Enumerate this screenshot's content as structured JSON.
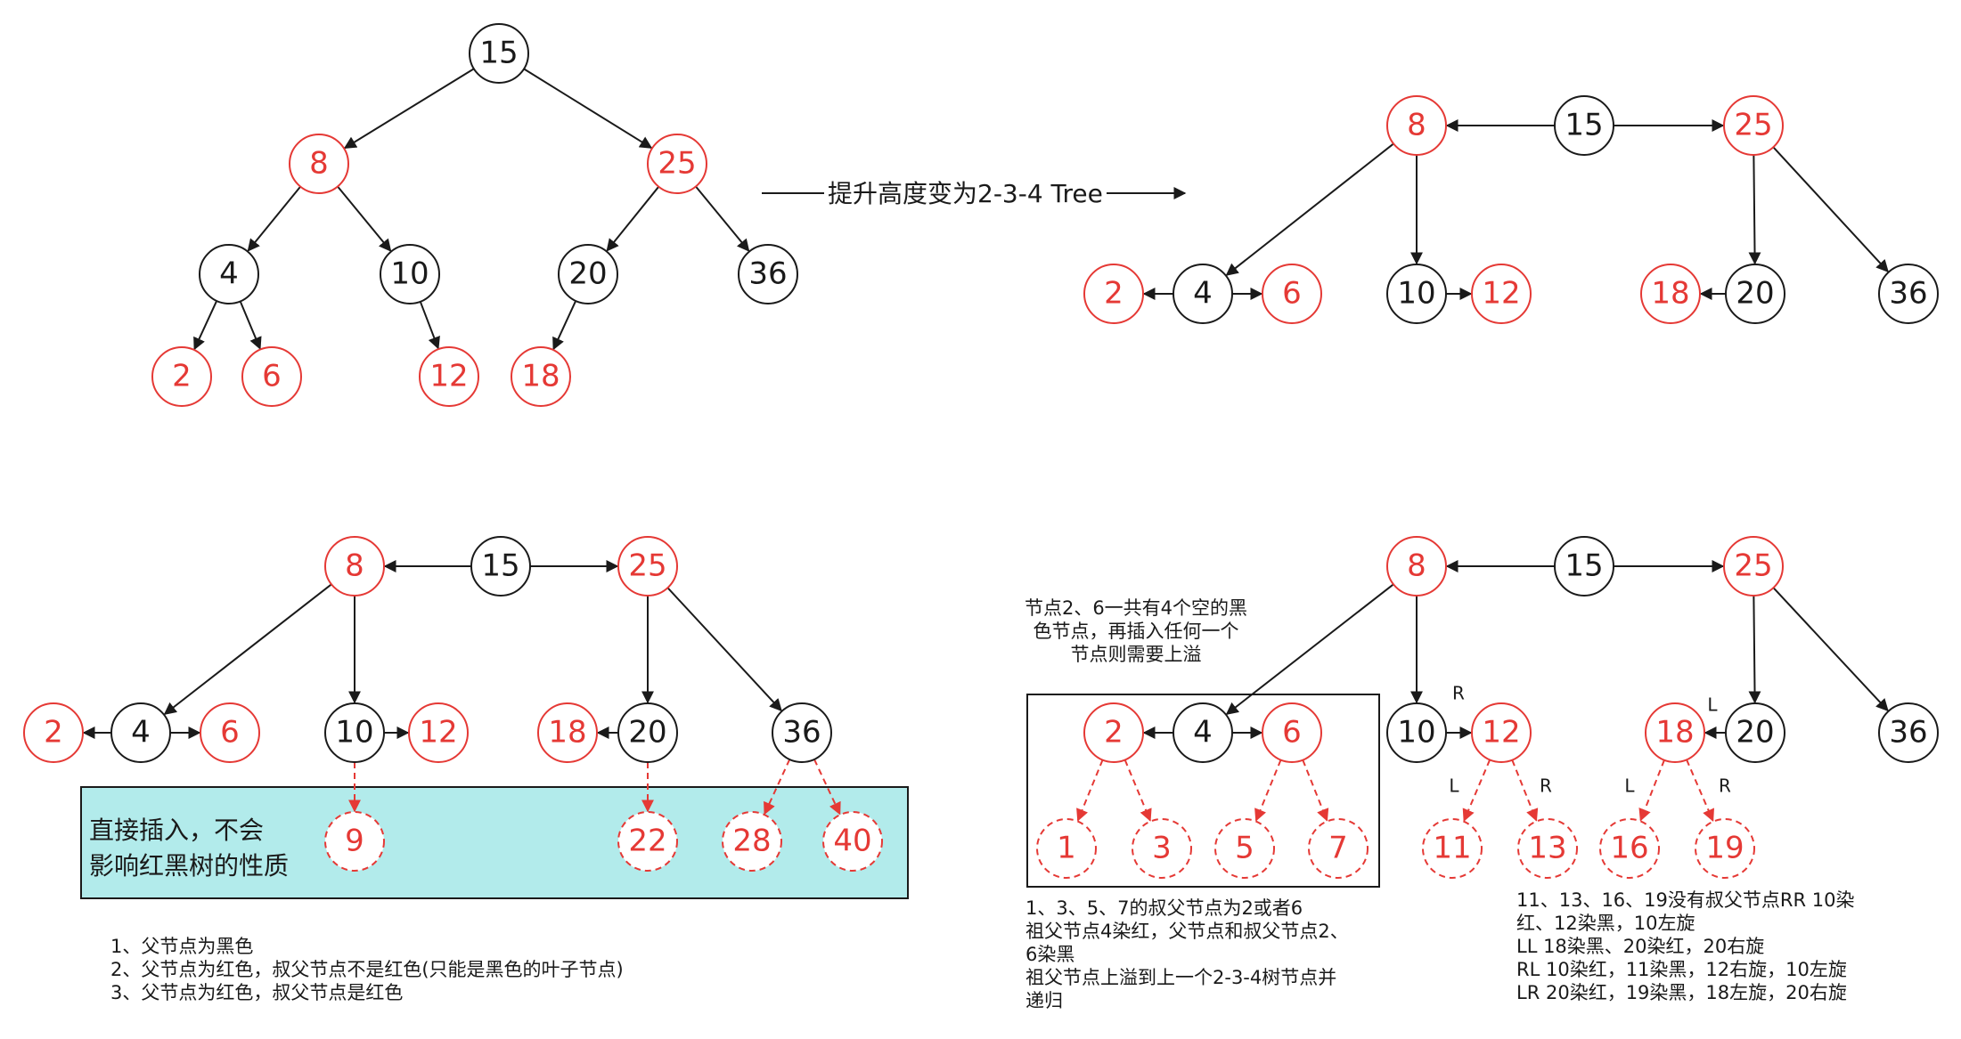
{
  "colors": {
    "red": "#e53935",
    "black": "#1a1a1a",
    "cyan": "#b2ebeb",
    "white": "#ffffff"
  },
  "top_arrow_label": "提升高度变为2-3-4 Tree",
  "tl_tree": {
    "nodes": [
      {
        "id": "15",
        "label": "15",
        "color": "black"
      },
      {
        "id": "8",
        "label": "8",
        "color": "red"
      },
      {
        "id": "25",
        "label": "25",
        "color": "red"
      },
      {
        "id": "4",
        "label": "4",
        "color": "black"
      },
      {
        "id": "10",
        "label": "10",
        "color": "black"
      },
      {
        "id": "20",
        "label": "20",
        "color": "black"
      },
      {
        "id": "36",
        "label": "36",
        "color": "black"
      },
      {
        "id": "2",
        "label": "2",
        "color": "red"
      },
      {
        "id": "6",
        "label": "6",
        "color": "red"
      },
      {
        "id": "12",
        "label": "12",
        "color": "red"
      },
      {
        "id": "18",
        "label": "18",
        "color": "red"
      }
    ],
    "edges": [
      {
        "from": "15",
        "to": "8"
      },
      {
        "from": "15",
        "to": "25"
      },
      {
        "from": "8",
        "to": "4"
      },
      {
        "from": "8",
        "to": "10"
      },
      {
        "from": "25",
        "to": "20"
      },
      {
        "from": "25",
        "to": "36"
      },
      {
        "from": "4",
        "to": "2"
      },
      {
        "from": "4",
        "to": "6"
      },
      {
        "from": "10",
        "to": "12"
      },
      {
        "from": "20",
        "to": "18"
      }
    ]
  },
  "tr_tree": {
    "nodes": [
      {
        "id": "8",
        "label": "8",
        "color": "red"
      },
      {
        "id": "15",
        "label": "15",
        "color": "black"
      },
      {
        "id": "25",
        "label": "25",
        "color": "red"
      },
      {
        "id": "2",
        "label": "2",
        "color": "red"
      },
      {
        "id": "4",
        "label": "4",
        "color": "black"
      },
      {
        "id": "6",
        "label": "6",
        "color": "red"
      },
      {
        "id": "10",
        "label": "10",
        "color": "black"
      },
      {
        "id": "12",
        "label": "12",
        "color": "red"
      },
      {
        "id": "18",
        "label": "18",
        "color": "red"
      },
      {
        "id": "20",
        "label": "20",
        "color": "black"
      },
      {
        "id": "36",
        "label": "36",
        "color": "black"
      }
    ],
    "edges": [
      {
        "from": "15",
        "to": "8"
      },
      {
        "from": "15",
        "to": "25"
      },
      {
        "from": "8",
        "to": "4"
      },
      {
        "from": "8",
        "to": "10"
      },
      {
        "from": "25",
        "to": "20"
      },
      {
        "from": "25",
        "to": "36"
      },
      {
        "from": "4",
        "to": "2"
      },
      {
        "from": "4",
        "to": "6"
      },
      {
        "from": "10",
        "to": "12"
      },
      {
        "from": "20",
        "to": "18"
      }
    ]
  },
  "bl_tree": {
    "nodes": [
      {
        "id": "8",
        "label": "8",
        "color": "red"
      },
      {
        "id": "15",
        "label": "15",
        "color": "black"
      },
      {
        "id": "25",
        "label": "25",
        "color": "red"
      },
      {
        "id": "2",
        "label": "2",
        "color": "red"
      },
      {
        "id": "4",
        "label": "4",
        "color": "black"
      },
      {
        "id": "6",
        "label": "6",
        "color": "red"
      },
      {
        "id": "10",
        "label": "10",
        "color": "black"
      },
      {
        "id": "12",
        "label": "12",
        "color": "red"
      },
      {
        "id": "18",
        "label": "18",
        "color": "red"
      },
      {
        "id": "20",
        "label": "20",
        "color": "black"
      },
      {
        "id": "36",
        "label": "36",
        "color": "black"
      },
      {
        "id": "9",
        "label": "9",
        "color": "red",
        "dashed": true
      },
      {
        "id": "22",
        "label": "22",
        "color": "red",
        "dashed": true
      },
      {
        "id": "28",
        "label": "28",
        "color": "red",
        "dashed": true
      },
      {
        "id": "40",
        "label": "40",
        "color": "red",
        "dashed": true
      }
    ],
    "edges": [
      {
        "from": "15",
        "to": "8"
      },
      {
        "from": "15",
        "to": "25"
      },
      {
        "from": "8",
        "to": "4"
      },
      {
        "from": "8",
        "to": "10"
      },
      {
        "from": "25",
        "to": "20"
      },
      {
        "from": "25",
        "to": "36"
      },
      {
        "from": "4",
        "to": "2"
      },
      {
        "from": "4",
        "to": "6"
      },
      {
        "from": "10",
        "to": "12"
      },
      {
        "from": "20",
        "to": "18"
      },
      {
        "from": "10",
        "to": "9",
        "dashed": true
      },
      {
        "from": "20",
        "to": "22",
        "dashed": true
      },
      {
        "from": "36",
        "to": "28",
        "dashed": true
      },
      {
        "from": "36",
        "to": "40",
        "dashed": true
      }
    ],
    "box_label_1": "直接插入，不会",
    "box_label_2": "影响红黑树的性质"
  },
  "br_tree": {
    "nodes": [
      {
        "id": "8",
        "label": "8",
        "color": "red"
      },
      {
        "id": "15",
        "label": "15",
        "color": "black"
      },
      {
        "id": "25",
        "label": "25",
        "color": "red"
      },
      {
        "id": "2",
        "label": "2",
        "color": "red"
      },
      {
        "id": "4",
        "label": "4",
        "color": "black"
      },
      {
        "id": "6",
        "label": "6",
        "color": "red"
      },
      {
        "id": "10",
        "label": "10",
        "color": "black"
      },
      {
        "id": "12",
        "label": "12",
        "color": "red"
      },
      {
        "id": "18",
        "label": "18",
        "color": "red"
      },
      {
        "id": "20",
        "label": "20",
        "color": "black"
      },
      {
        "id": "36",
        "label": "36",
        "color": "black"
      },
      {
        "id": "1",
        "label": "1",
        "color": "red",
        "dashed": true
      },
      {
        "id": "3",
        "label": "3",
        "color": "red",
        "dashed": true
      },
      {
        "id": "5",
        "label": "5",
        "color": "red",
        "dashed": true
      },
      {
        "id": "7",
        "label": "7",
        "color": "red",
        "dashed": true
      },
      {
        "id": "11",
        "label": "11",
        "color": "red",
        "dashed": true
      },
      {
        "id": "13",
        "label": "13",
        "color": "red",
        "dashed": true
      },
      {
        "id": "16",
        "label": "16",
        "color": "red",
        "dashed": true
      },
      {
        "id": "19",
        "label": "19",
        "color": "red",
        "dashed": true
      }
    ],
    "edges": [
      {
        "from": "15",
        "to": "8"
      },
      {
        "from": "15",
        "to": "25"
      },
      {
        "from": "8",
        "to": "4"
      },
      {
        "from": "8",
        "to": "10"
      },
      {
        "from": "25",
        "to": "20"
      },
      {
        "from": "25",
        "to": "36"
      },
      {
        "from": "4",
        "to": "2"
      },
      {
        "from": "4",
        "to": "6"
      },
      {
        "from": "10",
        "to": "12"
      },
      {
        "from": "20",
        "to": "18"
      },
      {
        "from": "2",
        "to": "1",
        "dashed": true
      },
      {
        "from": "2",
        "to": "3",
        "dashed": true
      },
      {
        "from": "6",
        "to": "5",
        "dashed": true
      },
      {
        "from": "6",
        "to": "7",
        "dashed": true
      },
      {
        "from": "12",
        "to": "11",
        "dashed": true
      },
      {
        "from": "12",
        "to": "13",
        "dashed": true
      },
      {
        "from": "18",
        "to": "16",
        "dashed": true
      },
      {
        "from": "18",
        "to": "19",
        "dashed": true
      }
    ],
    "edge_labels": [
      {
        "id": "10-12",
        "text": "R"
      },
      {
        "id": "20-18",
        "text": "L"
      },
      {
        "id": "12-11",
        "text": "L"
      },
      {
        "id": "12-13",
        "text": "R"
      },
      {
        "id": "18-16",
        "text": "L"
      },
      {
        "id": "18-19",
        "text": "R"
      }
    ]
  },
  "note_top": {
    "line1": "节点2、6一共有4个空的黑",
    "line2": "色节点，再插入任何一个",
    "line3": "节点则需要上溢"
  },
  "note_box_bottom": {
    "line1": "1、3、5、7的叔父节点为2或者6",
    "line2": "祖父节点4染红，父节点和叔父节点2、",
    "line3": "6染黑",
    "line4": "祖父节点上溢到上一个2-3-4树节点并",
    "line5": "递归"
  },
  "note_right": {
    "line1": "11、13、16、19没有叔父节点RR 10染",
    "line2": "红、12染黑，10左旋",
    "line3": "LL  18染黑、20染红，20右旋",
    "line4": "RL  10染红，11染黑，12右旋，10左旋",
    "line5": "LR  20染红，19染黑，18左旋，20右旋"
  },
  "rules": [
    "1、父节点为黑色",
    "2、父节点为红色，叔父节点不是红色(只能是黑色的叶子节点)",
    "3、父节点为红色，叔父节点是红色"
  ]
}
